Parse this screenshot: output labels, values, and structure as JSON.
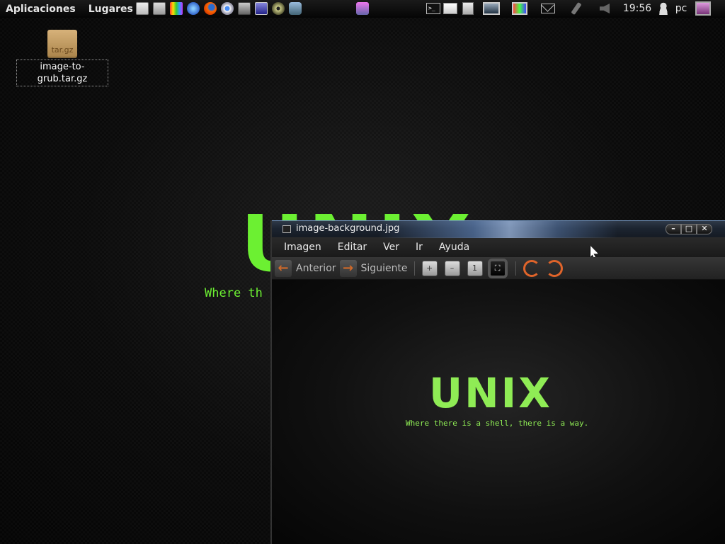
{
  "panel": {
    "menu_applications": "Aplicaciones",
    "menu_places": "Lugares",
    "launchers": [
      "text-editor-icon",
      "form-icon",
      "paint-icon",
      "database-icon",
      "firefox-icon",
      "chrome-icon",
      "screenshot-icon",
      "monitor-icon",
      "disc-icon",
      "network-icon"
    ],
    "center_icon": "mail-icon",
    "tray_icons": [
      "terminal-icon",
      "folder-icon",
      "archive-icon",
      "display-icon",
      "color-icon",
      "envelope-icon",
      "plug-icon",
      "volume-icon"
    ],
    "clock": "19:56",
    "user": "pc"
  },
  "desktop": {
    "icon_badge": "tar.gz",
    "icon_label": "image-to-grub.tar.gz"
  },
  "wallpaper": {
    "logo": "UNIX",
    "tagline": "Where th"
  },
  "window": {
    "title": "image-background.jpg",
    "controls": {
      "minimize": "–",
      "maximize": "□",
      "close": "✕"
    },
    "menu": [
      "Imagen",
      "Editar",
      "Ver",
      "Ir",
      "Ayuda"
    ],
    "toolbar": {
      "previous": "Anterior",
      "next": "Siguiente",
      "zoom_in": "+",
      "zoom_out": "–",
      "normal_size": "1",
      "best_fit": "⛶"
    },
    "image": {
      "logo": "UNIX",
      "tagline": "Where there is a shell, there is a way."
    }
  }
}
